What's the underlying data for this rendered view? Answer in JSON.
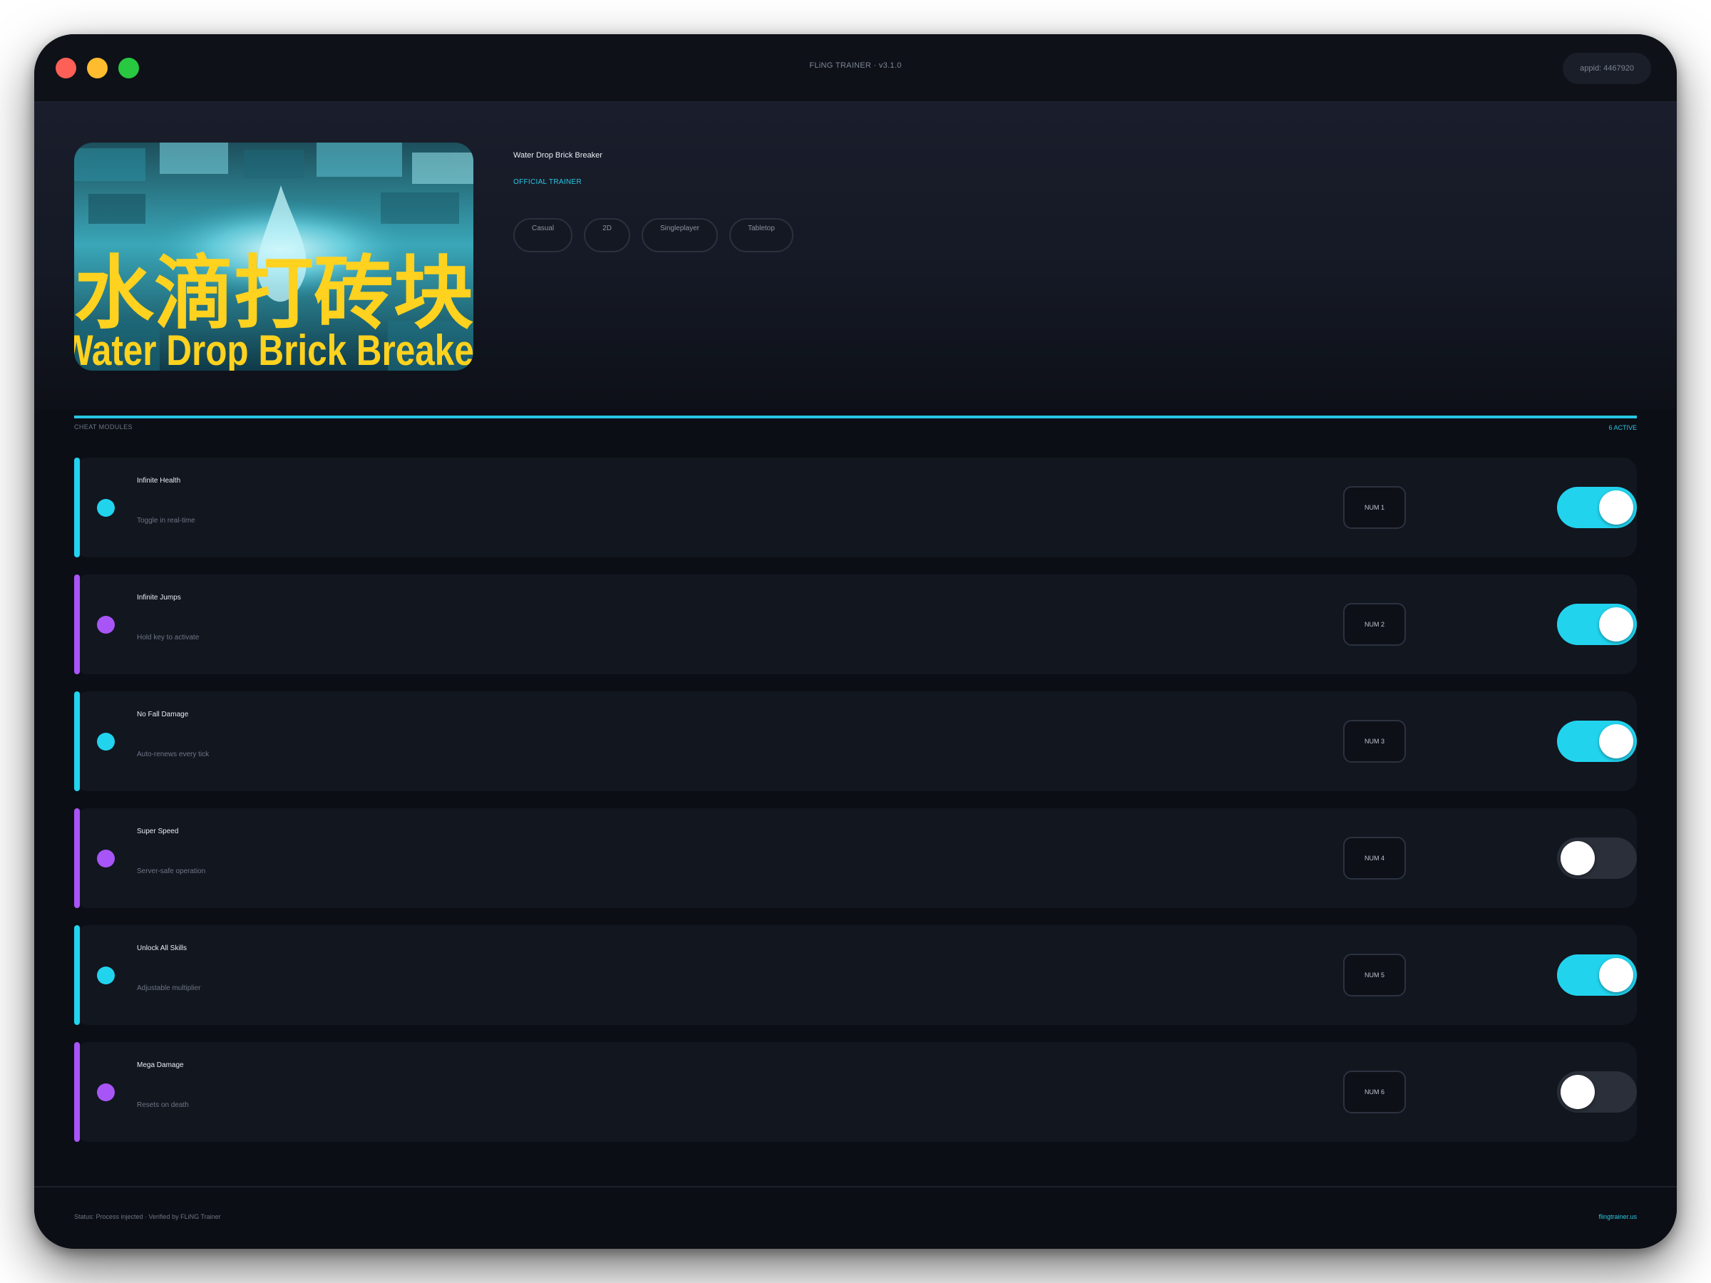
{
  "window": {
    "title": "FLiNG TRAINER · v3.1.0",
    "appid": "appid: 4467920"
  },
  "game": {
    "title": "Water Drop Brick Breaker",
    "badge": "OFFICIAL TRAINER",
    "tags": [
      "Casual",
      "2D",
      "Singleplayer",
      "Tabletop"
    ],
    "cover": {
      "title_cn": "水滴打砖块",
      "title_en": "Water Drop Brick Breaker"
    }
  },
  "section": {
    "label": "CHEAT MODULES",
    "count": "6 ACTIVE"
  },
  "cheats": [
    {
      "name": "Infinite Health",
      "description": "Toggle in real-time",
      "hotkey": "NUM 1",
      "enabled": true,
      "accent": "#22d3ee"
    },
    {
      "name": "Infinite Jumps",
      "description": "Hold key to activate",
      "hotkey": "NUM 2",
      "enabled": true,
      "accent": "#a855f7"
    },
    {
      "name": "No Fall Damage",
      "description": "Auto-renews every tick",
      "hotkey": "NUM 3",
      "enabled": true,
      "accent": "#22d3ee"
    },
    {
      "name": "Super Speed",
      "description": "Server-safe operation",
      "hotkey": "NUM 4",
      "enabled": false,
      "accent": "#a855f7"
    },
    {
      "name": "Unlock All Skills",
      "description": "Adjustable multiplier",
      "hotkey": "NUM 5",
      "enabled": true,
      "accent": "#22d3ee"
    },
    {
      "name": "Mega Damage",
      "description": "Resets on death",
      "hotkey": "NUM 6",
      "enabled": false,
      "accent": "#a855f7"
    }
  ],
  "footer": {
    "status": "Status: Process injected · Verified by FLiNG Trainer",
    "link": "flingtrainer.us"
  },
  "colors": {
    "accent_cyan": "#22d3ee",
    "accent_purple": "#a855f7",
    "toggle_off": "#2a2f3a",
    "background": "#0b0e14"
  },
  "icons": [
    "close-dot-icon",
    "minimize-dot-icon",
    "maximize-dot-icon",
    "status-dot-icon"
  ]
}
